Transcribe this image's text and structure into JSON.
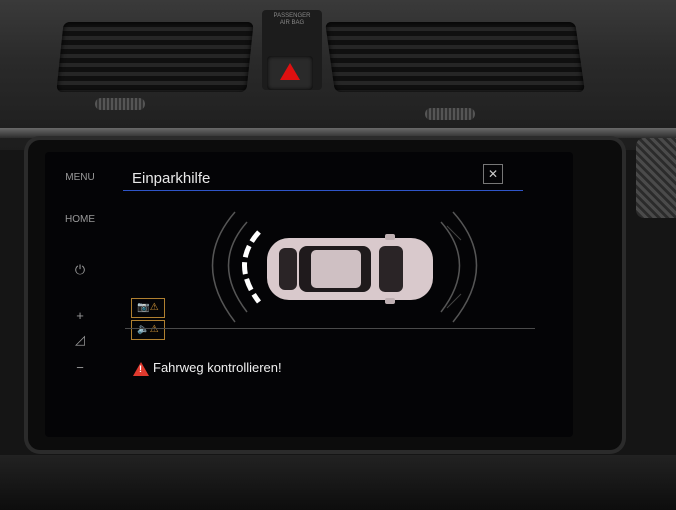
{
  "surroundings": {
    "airbag_label_line1": "PASSENGER",
    "airbag_label_line2": "AIR BAG"
  },
  "sidebar": {
    "menu_label": "MENU",
    "home_label": "HOME",
    "power_icon": "power-icon",
    "volume_up_label": "+",
    "volume_down_label": "−"
  },
  "header": {
    "title": "Einparkhilfe",
    "close_glyph": "✕"
  },
  "parking": {
    "sensor_color_active": "#ffffff",
    "sensor_color_inactive": "#555555",
    "car_color": "#d9c9cc"
  },
  "mode_buttons": [
    {
      "icon": "camera-sound-icon",
      "glyph": "📷⚠"
    },
    {
      "icon": "speaker-mute-icon",
      "glyph": "🔈⚠"
    }
  ],
  "warning": {
    "text": "Fahrweg kontrollieren!",
    "color": "#e03a2e"
  }
}
